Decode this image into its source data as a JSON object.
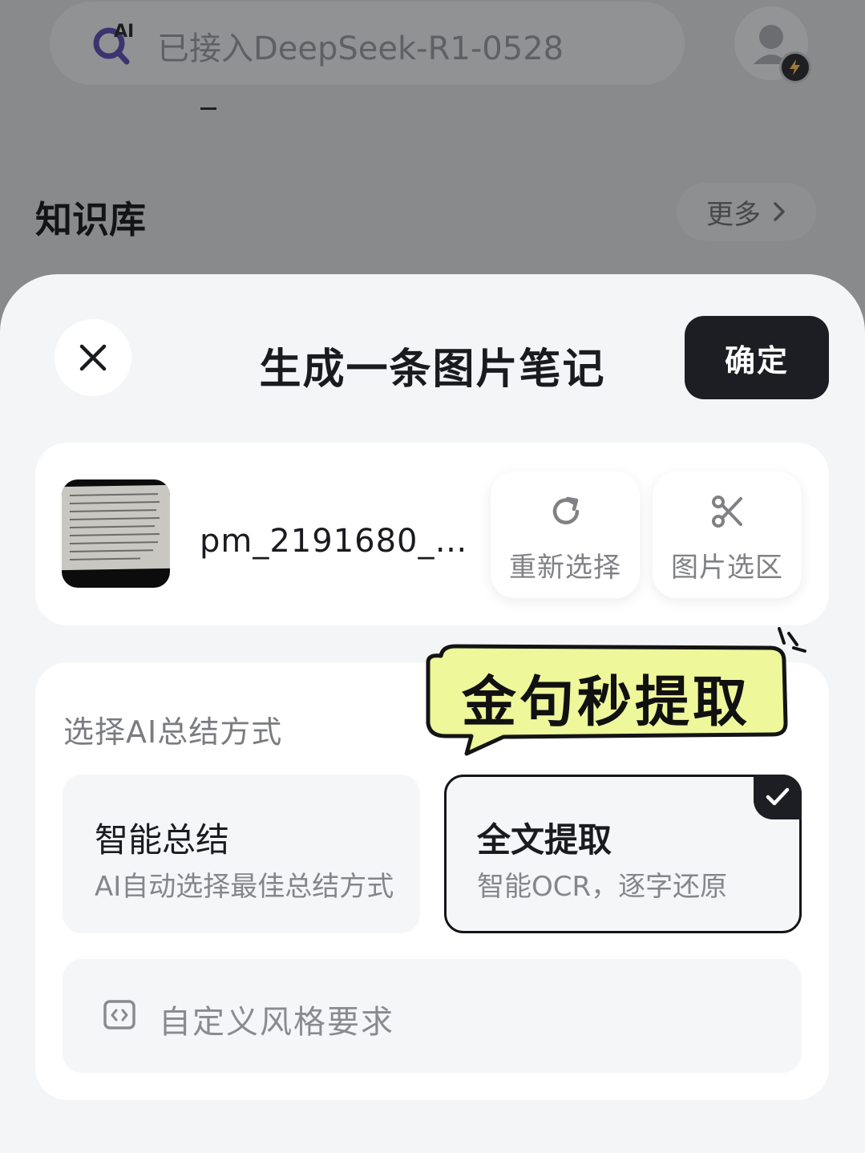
{
  "background": {
    "search": {
      "logo_text": "AI",
      "placeholder": "已接入DeepSeek-R1-0528"
    },
    "section_title": "知识库",
    "more_label": "更多"
  },
  "sheet": {
    "title": "生成一条图片笔记",
    "confirm_label": "确定",
    "file": {
      "name": "pm_2191680_…",
      "reselect_label": "重新选择",
      "crop_label": "图片选区"
    },
    "mode": {
      "heading": "选择AI总结方式",
      "sticker_text": "金句秒提取",
      "options": [
        {
          "title": "智能总结",
          "subtitle": "AI自动选择最佳总结方式",
          "selected": false
        },
        {
          "title": "全文提取",
          "subtitle": "智能OCR，逐字还原",
          "selected": true
        }
      ],
      "custom_label": "自定义风格要求"
    }
  },
  "colors": {
    "accent_dark": "#1c1e24",
    "sticker_fill": "#eef79a",
    "sheet_bg": "#f4f5f7",
    "overlay_bg": "#898a8c"
  },
  "icons": {
    "close": "close-icon",
    "reselect": "refresh-icon",
    "crop": "scissors-icon",
    "check": "check-icon",
    "custom": "code-bracket-icon",
    "chevron": "chevron-right-icon"
  }
}
